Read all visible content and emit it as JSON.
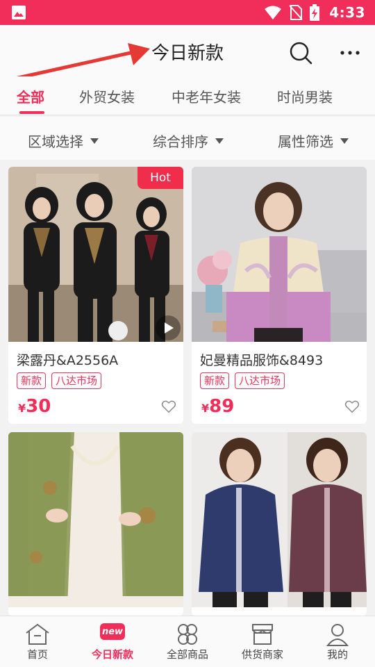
{
  "status_bar": {
    "time": "4:33"
  },
  "header": {
    "title": "今日新款"
  },
  "tabs": [
    {
      "label": "全部",
      "active": true
    },
    {
      "label": "外贸女装",
      "active": false
    },
    {
      "label": "中老年女装",
      "active": false
    },
    {
      "label": "时尚男装",
      "active": false
    }
  ],
  "filters": [
    {
      "label": "区域选择"
    },
    {
      "label": "综合排序"
    },
    {
      "label": "属性筛选"
    }
  ],
  "products": [
    {
      "name": "梁露丹&A2556A",
      "tags": [
        "新款",
        "八达市场"
      ],
      "currency": "¥",
      "price": "30",
      "badge": "Hot",
      "has_video": true
    },
    {
      "name": "妃曼精品服饰&8493",
      "tags": [
        "新款",
        "八达市场"
      ],
      "currency": "¥",
      "price": "89"
    },
    {
      "name": "",
      "tags": [],
      "currency": "",
      "price": ""
    },
    {
      "name": "",
      "tags": [],
      "currency": "",
      "price": ""
    }
  ],
  "bottom_nav": [
    {
      "label": "首页",
      "icon": "home-icon",
      "active": false
    },
    {
      "label": "今日新款",
      "icon": "new-badge-icon",
      "badge": "new",
      "active": true
    },
    {
      "label": "全部商品",
      "icon": "grid-flower-icon",
      "active": false
    },
    {
      "label": "供货商家",
      "icon": "store-icon",
      "active": false
    },
    {
      "label": "我的",
      "icon": "profile-icon",
      "active": false
    }
  ],
  "colors": {
    "accent": "#f12d5a",
    "status_bar": "#f12d5a",
    "arrow": "#e53935"
  }
}
